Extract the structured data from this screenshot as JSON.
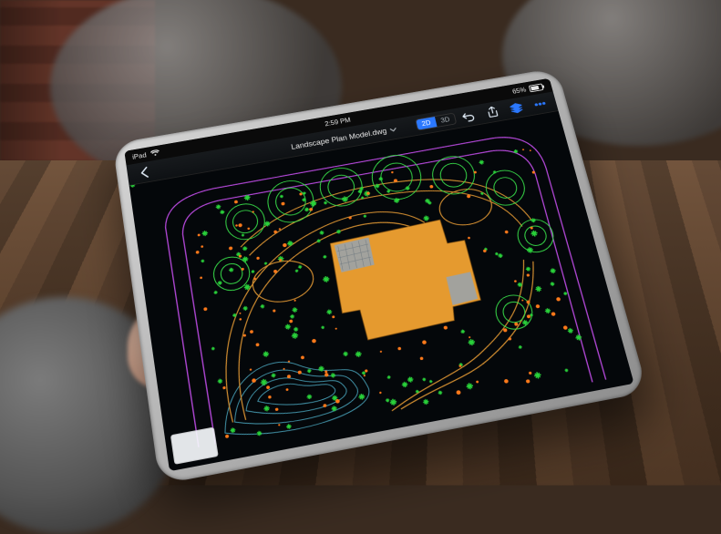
{
  "statusbar": {
    "carrier": "iPad",
    "wifi": "wifi",
    "time": "2:59 PM",
    "battery_text": "65%",
    "battery_level": 65
  },
  "appbar": {
    "back_icon": "chevron-left",
    "filename": "Landscape Plan Model.dwg",
    "dropdown_icon": "chevron-down",
    "segmented": {
      "option_a": "2D",
      "option_b": "3D",
      "active": "2D"
    },
    "tools": {
      "undo": "undo",
      "share": "share",
      "layers": "layers",
      "more": "more"
    }
  },
  "colors": {
    "accent": "#2b78ff",
    "canvas_bg": "#04070a",
    "building_fill": "#e59a2f",
    "roof_fill": "#9aa3aa",
    "path_line": "#d48f31",
    "contour_line": "#4fb0c9",
    "wall_line": "#b94adf",
    "shrub_green": "#29d13a",
    "tree_ring_green": "#39e04a",
    "flower_orange": "#ff7a1a"
  },
  "drawing": {
    "title": "Landscape Plan",
    "layers": [
      {
        "name": "Building Footprint",
        "type": "polygon",
        "color": "building_fill"
      },
      {
        "name": "Roof / Hardscape",
        "type": "polygon",
        "color": "roof_fill"
      },
      {
        "name": "Walkways",
        "type": "polyline",
        "color": "path_line"
      },
      {
        "name": "Garden Beds",
        "type": "spline",
        "color": "path_line"
      },
      {
        "name": "Topo Contours",
        "type": "spline",
        "color": "contour_line"
      },
      {
        "name": "Property Wall",
        "type": "polyline",
        "color": "wall_line"
      },
      {
        "name": "Trees",
        "type": "circle",
        "color": "tree_ring_green"
      },
      {
        "name": "Shrubs",
        "type": "point",
        "color": "shrub_green"
      },
      {
        "name": "Annual Beds",
        "type": "point",
        "color": "flower_orange"
      }
    ]
  }
}
